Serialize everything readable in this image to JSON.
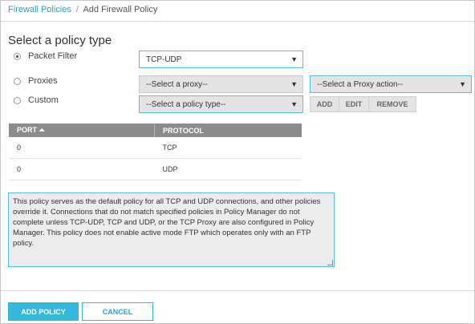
{
  "breadcrumb": {
    "parent": "Firewall Policies",
    "separator": "/",
    "current": "Add Firewall Policy"
  },
  "section_title": "Select a policy type",
  "policy_types": [
    {
      "label": "Packet Filter",
      "selected": true
    },
    {
      "label": "Proxies",
      "selected": false
    },
    {
      "label": "Custom",
      "selected": false
    }
  ],
  "selects": {
    "packet_filter": "TCP-UDP",
    "proxy": "--Select a proxy--",
    "proxy_action": "--Select a Proxy action--",
    "policy_type": "--Select a policy type--",
    "caret": "▼"
  },
  "custom_buttons": {
    "add": "ADD",
    "edit": "EDIT",
    "remove": "REMOVE"
  },
  "table": {
    "headers": {
      "port": "PORT",
      "sort_icon": "⏶",
      "protocol": "PROTOCOL"
    },
    "rows": [
      {
        "port": "0",
        "protocol": "TCP"
      },
      {
        "port": "0",
        "protocol": "UDP"
      }
    ]
  },
  "description": "This policy serves as the default policy for all TCP and UDP connections, and other policies override it. Connections that do not match specified policies in Policy Manager do not complete unless TCP-UDP, TCP and UDP, or the TCP Proxy are also configured in Policy Manager. This policy does not enable active mode FTP which operates only with an FTP policy.",
  "footer": {
    "add_policy": "ADD POLICY",
    "cancel": "CANCEL"
  },
  "colors": {
    "accent": "#33b9d9",
    "table_header": "#8c8c8c",
    "field_gray": "#e4e4e4"
  }
}
